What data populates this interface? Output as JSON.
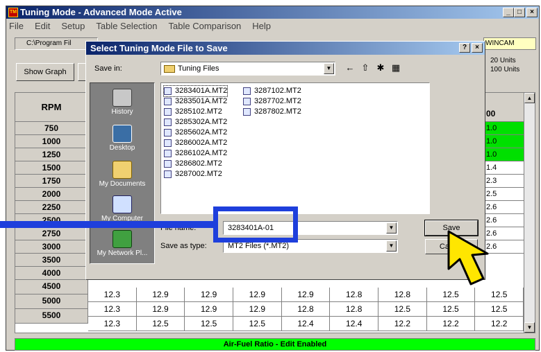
{
  "window": {
    "title": "Tuning Mode - Advanced Mode Active",
    "app_icon": "app-logo"
  },
  "menu": [
    "File",
    "Edit",
    "Setup",
    "Table Selection",
    "Table Comparison",
    "Help"
  ],
  "toolbar": {
    "path": "C:\\Program Fil",
    "wincam": "WINCAM",
    "show_graph": "Show Graph",
    "units_line1": "20 Units",
    "units_line2": "100 Units"
  },
  "grid": {
    "rpm_header": "RPM",
    "rpm_values": [
      "750",
      "1000",
      "1250",
      "1500",
      "1750",
      "2000",
      "2250",
      "2500",
      "2750",
      "3000",
      "3500",
      "4000",
      "4500",
      "5000",
      "5500"
    ],
    "right_header": "00",
    "right_values": [
      "1.0",
      "1.0",
      "1.0",
      "1.4",
      "2.3",
      "2.5",
      "2.6",
      "2.6",
      "2.6",
      "2.6"
    ],
    "visible_rows": [
      {
        "rpm": "4500",
        "cells": [
          "12.3",
          "12.9",
          "12.9",
          "12.9",
          "12.9",
          "12.8",
          "12.8",
          "12.5",
          "12.5"
        ]
      },
      {
        "rpm": "5000",
        "cells": [
          "12.3",
          "12.9",
          "12.9",
          "12.9",
          "12.8",
          "12.8",
          "12.5",
          "12.5",
          "12.5"
        ]
      },
      {
        "rpm": "5500",
        "cells": [
          "12.3",
          "12.5",
          "12.5",
          "12.5",
          "12.4",
          "12.4",
          "12.2",
          "12.2",
          "12.2"
        ]
      }
    ]
  },
  "status": "Air-Fuel Ratio - Edit Enabled",
  "dialog": {
    "title": "Select Tuning Mode File to Save",
    "save_in_label": "Save in:",
    "save_in_value": "Tuning Files",
    "places": [
      "History",
      "Desktop",
      "My Documents",
      "My Computer",
      "My Network Pl..."
    ],
    "files_col1": [
      "3283401A.MT2",
      "3283501A.MT2",
      "3285102.MT2",
      "3285302A.MT2",
      "3285602A.MT2",
      "3286002A.MT2",
      "3286102A.MT2",
      "3286802.MT2",
      "3287002.MT2"
    ],
    "files_col2": [
      "3287102.MT2",
      "3287702.MT2",
      "3287802.MT2"
    ],
    "file_name_label": "File name:",
    "file_name_value": "3283401A-01",
    "save_type_label": "Save as type:",
    "save_type_value": "MT2 Files (*.MT2)",
    "save_button": "Save",
    "cancel_button": "Cancel"
  }
}
